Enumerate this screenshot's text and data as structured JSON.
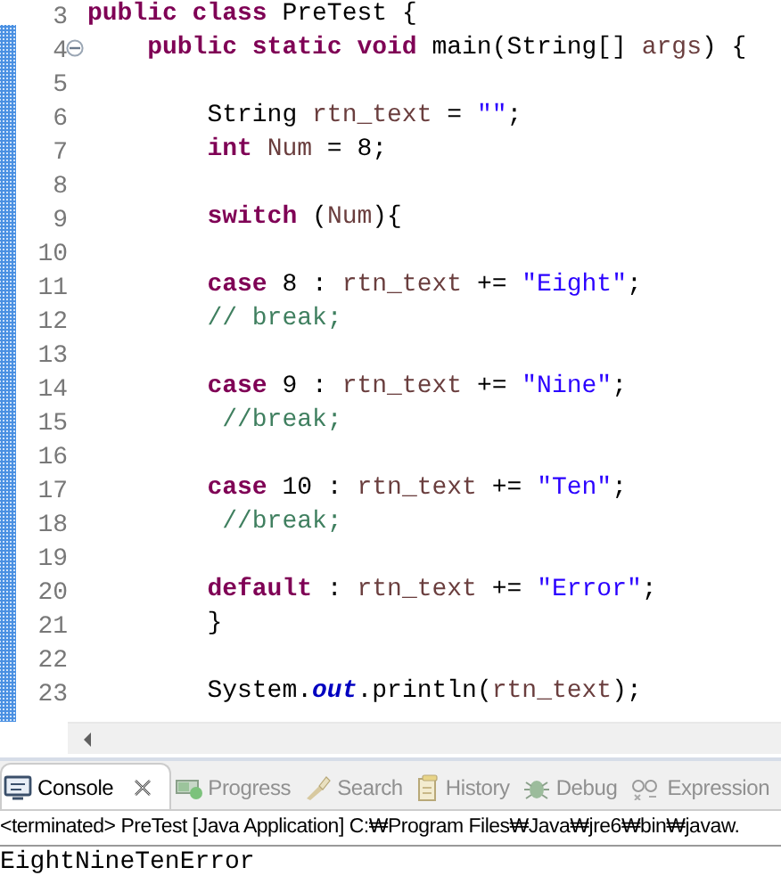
{
  "editor": {
    "lines": [
      {
        "number": "3",
        "kind": "class",
        "tokens": [
          {
            "text": "public class",
            "kind": "keyword"
          },
          {
            "text": " PreTest {",
            "kind": "plain"
          }
        ]
      },
      {
        "number": "4",
        "collapsed": false,
        "kind": "member",
        "tokens": [
          {
            "text": "public static void",
            "kind": "keyword"
          },
          {
            "text": " main(String[] ",
            "kind": "plain"
          },
          {
            "text": "args",
            "kind": "variable"
          },
          {
            "text": ") {",
            "kind": "plain"
          }
        ]
      },
      {
        "number": "5"
      },
      {
        "number": "6",
        "kind": "statement",
        "tokens": [
          {
            "text": "String ",
            "kind": "plain"
          },
          {
            "text": "rtn_text",
            "kind": "variable"
          },
          {
            "text": " = ",
            "kind": "plain"
          },
          {
            "text": "\"\"",
            "kind": "string"
          },
          {
            "text": ";",
            "kind": "plain"
          }
        ]
      },
      {
        "number": "7",
        "kind": "statement",
        "tokens": [
          {
            "text": "int",
            "kind": "keyword"
          },
          {
            "text": " Num",
            "kind": "variable"
          },
          {
            "text": " = 8;",
            "kind": "plain"
          }
        ]
      },
      {
        "number": "8"
      },
      {
        "number": "9",
        "kind": "statement",
        "tokens": [
          {
            "text": "switch",
            "kind": "keyword"
          },
          {
            "text": " (",
            "kind": "plain"
          },
          {
            "text": "Num",
            "kind": "variable"
          },
          {
            "text": "){",
            "kind": "plain"
          }
        ]
      },
      {
        "number": "10"
      },
      {
        "number": "11",
        "kind": "statement",
        "tokens": [
          {
            "text": "case",
            "kind": "keyword"
          },
          {
            "text": " 8 : ",
            "kind": "plain"
          },
          {
            "text": "rtn_text",
            "kind": "variable"
          },
          {
            "text": " += ",
            "kind": "plain"
          },
          {
            "text": "\"Eight\"",
            "kind": "string"
          },
          {
            "text": ";",
            "kind": "plain"
          }
        ]
      },
      {
        "number": "12",
        "kind": "statement",
        "tokens": [
          {
            "text": "// break;",
            "kind": "comment"
          }
        ]
      },
      {
        "number": "13"
      },
      {
        "number": "14",
        "kind": "statement",
        "tokens": [
          {
            "text": "case",
            "kind": "keyword"
          },
          {
            "text": " 9 : ",
            "kind": "plain"
          },
          {
            "text": "rtn_text",
            "kind": "variable"
          },
          {
            "text": " += ",
            "kind": "plain"
          },
          {
            "text": "\"Nine\"",
            "kind": "string"
          },
          {
            "text": ";",
            "kind": "plain"
          }
        ]
      },
      {
        "number": "15",
        "kind": "statement",
        "tokens": [
          {
            "text": " //break;",
            "kind": "comment"
          }
        ]
      },
      {
        "number": "16"
      },
      {
        "number": "17",
        "kind": "statement",
        "tokens": [
          {
            "text": "case",
            "kind": "keyword"
          },
          {
            "text": " 10 : ",
            "kind": "plain"
          },
          {
            "text": "rtn_text",
            "kind": "variable"
          },
          {
            "text": " += ",
            "kind": "plain"
          },
          {
            "text": "\"Ten\"",
            "kind": "string"
          },
          {
            "text": ";",
            "kind": "plain"
          }
        ]
      },
      {
        "number": "18",
        "kind": "statement",
        "tokens": [
          {
            "text": " //break;",
            "kind": "comment"
          }
        ]
      },
      {
        "number": "19"
      },
      {
        "number": "20",
        "kind": "statement",
        "tokens": [
          {
            "text": "default",
            "kind": "keyword"
          },
          {
            "text": " : ",
            "kind": "plain"
          },
          {
            "text": "rtn_text",
            "kind": "variable"
          },
          {
            "text": " += ",
            "kind": "plain"
          },
          {
            "text": "\"Error\"",
            "kind": "string"
          },
          {
            "text": ";",
            "kind": "plain"
          }
        ]
      },
      {
        "number": "21",
        "kind": "statement",
        "tokens": [
          {
            "text": "}",
            "kind": "plain"
          }
        ]
      },
      {
        "number": "22"
      },
      {
        "number": "23",
        "kind": "statement",
        "tokens": [
          {
            "text": "System.",
            "kind": "plain"
          },
          {
            "text": "out",
            "kind": "field"
          },
          {
            "text": ".println(",
            "kind": "plain"
          },
          {
            "text": "rtn_text",
            "kind": "variable"
          },
          {
            "text": ");",
            "kind": "plain"
          }
        ]
      }
    ]
  },
  "views": {
    "tabs": [
      {
        "label": "Console",
        "kind": "console",
        "selected": true,
        "closable": true
      },
      {
        "label": "Progress",
        "kind": "progress",
        "selected": false,
        "closable": false
      },
      {
        "label": "Search",
        "kind": "search",
        "selected": false,
        "closable": false
      },
      {
        "label": "History",
        "kind": "history",
        "selected": false,
        "closable": false
      },
      {
        "label": "Debug",
        "kind": "debug",
        "selected": false,
        "closable": false
      },
      {
        "label": "Expression",
        "kind": "expressions",
        "selected": false,
        "closable": false
      }
    ],
    "console": {
      "status": "<terminated> PreTest [Java Application] C:₩Program Files₩Java₩jre6₩bin₩javaw.",
      "output": "EightNineTenError"
    }
  }
}
